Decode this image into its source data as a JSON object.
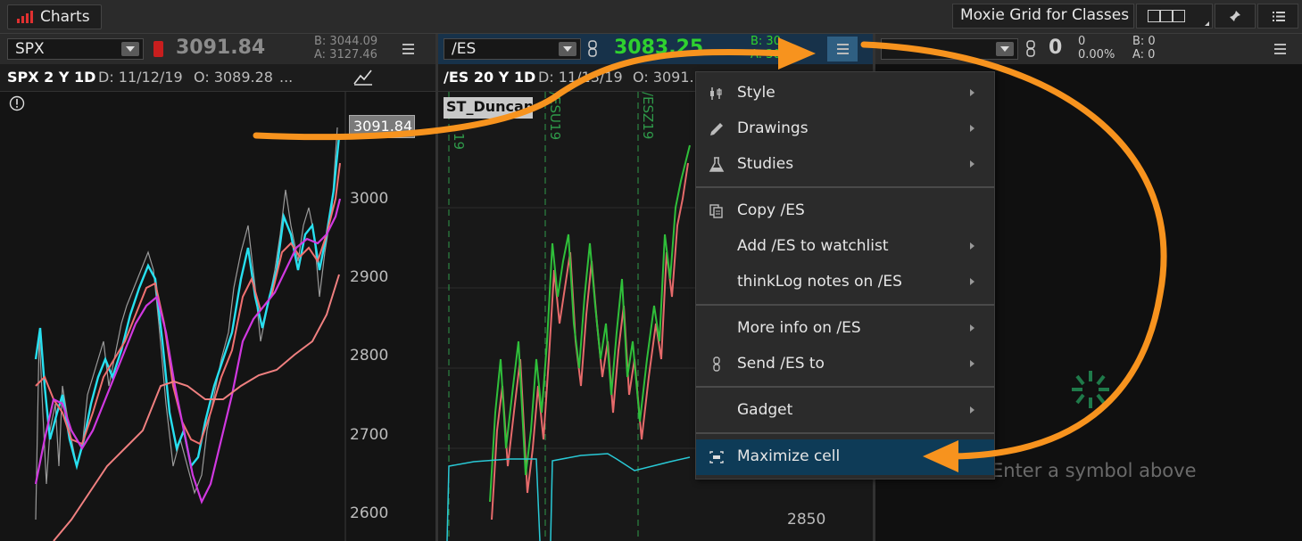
{
  "window": {
    "tab_label": "Charts",
    "grid_name": "Moxie Grid for Classes"
  },
  "cell1": {
    "symbol": "SPX",
    "last_price": "3091.84",
    "bid": "B: 3044.09",
    "ask": "A: 3127.46",
    "chart_title": "SPX 2 Y 1D",
    "date": "D: 11/12/19",
    "open": "O: 3089.28",
    "more": "...",
    "price_tag": "3091.84",
    "y_ticks": [
      "3000",
      "2900",
      "2800",
      "2700",
      "2600"
    ]
  },
  "cell2": {
    "symbol": "/ES",
    "last_price": "3083.25",
    "bid": "B: 30",
    "ask": "A: 30",
    "chart_title": "/ES 20 Y 1D",
    "date": "D: 11/13/19",
    "open": "O: 3091.",
    "study_label": "ST_Duncan",
    "expiry_labels": [
      "/ESU19",
      "/ESZ19",
      "19"
    ],
    "y_tick": "2850"
  },
  "cell3": {
    "symbol": "",
    "last_price": "0",
    "change": "0",
    "change_pct": "0.00%",
    "bid": "B: 0",
    "ask": "A: 0",
    "empty_message": "Enter a symbol above"
  },
  "context_menu": {
    "items": [
      {
        "label": "Style",
        "icon": "style-icon",
        "submenu": true
      },
      {
        "label": "Drawings",
        "icon": "pencil-icon",
        "submenu": true
      },
      {
        "label": "Studies",
        "icon": "flask-icon",
        "submenu": true
      },
      {
        "label": "Copy /ES",
        "icon": "copy-icon",
        "submenu": false
      },
      {
        "label": "Add /ES to watchlist",
        "icon": "",
        "submenu": true
      },
      {
        "label": "thinkLog notes on /ES",
        "icon": "",
        "submenu": true
      },
      {
        "label": "More info on /ES",
        "icon": "",
        "submenu": true
      },
      {
        "label": "Send /ES to",
        "icon": "link-icon",
        "submenu": true
      },
      {
        "label": "Gadget",
        "icon": "",
        "submenu": true
      },
      {
        "label": "Maximize cell",
        "icon": "maximize-icon",
        "submenu": false,
        "highlighted": true
      }
    ]
  },
  "colors": {
    "accent": "#f7931e",
    "highlight": "#0e3b57",
    "green": "#2fd12f",
    "cyan": "#27e0f0",
    "magenta": "#d038e0",
    "salmon": "#f08080"
  }
}
